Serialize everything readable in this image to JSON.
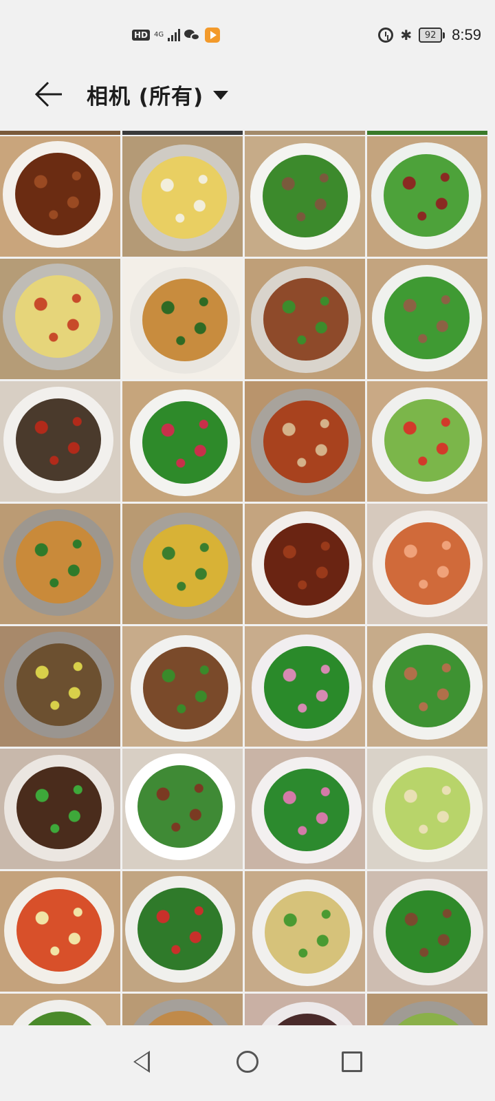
{
  "status_bar": {
    "hd_label": "HD",
    "network_label": "4G",
    "battery_level": "92",
    "time": "8:59"
  },
  "header": {
    "title": "相机 (所有)"
  },
  "colors": {
    "background": "#f1f1f1",
    "text": "#1d1d1d",
    "app_icon_orange": "#f39a2b"
  },
  "photos": [
    {
      "name": "braised-pork",
      "bg": "#c9a57c",
      "plate": "#f4f1ec",
      "food": "#6b2c12",
      "accent": "#9a4a22"
    },
    {
      "name": "eggs-onion",
      "bg": "#b49a76",
      "plate": "#cfcbc4",
      "food": "#e9cf62",
      "accent": "#f2eedb"
    },
    {
      "name": "chive-pork",
      "bg": "#c6ab88",
      "plate": "#f4f4f1",
      "food": "#3c8a2c",
      "accent": "#7a5a3c"
    },
    {
      "name": "sausage-greens",
      "bg": "#c4a47e",
      "plate": "#eef1ee",
      "food": "#4da23a",
      "accent": "#8a2a22"
    },
    {
      "name": "potato-strips",
      "bg": "#b59c77",
      "plate": "#bfbcb6",
      "food": "#e6d57a",
      "accent": "#c84a2a"
    },
    {
      "name": "tofu-greens",
      "bg": "#f3efe8",
      "plate": "#e9e6e0",
      "food": "#c88c3e",
      "accent": "#2f6a24"
    },
    {
      "name": "table-spread",
      "bg": "#bf9f78",
      "plate": "#d9d4cc",
      "food": "#8e4a2a",
      "accent": "#3c8c2c"
    },
    {
      "name": "green-bean-pork",
      "bg": "#c3a47f",
      "plate": "#f0f1ee",
      "food": "#3f9a33",
      "accent": "#8c6244"
    },
    {
      "name": "braised-fish",
      "bg": "#d8cfc4",
      "plate": "#f2f0ed",
      "food": "#4a3a2c",
      "accent": "#b12a1a"
    },
    {
      "name": "stir-fry-greens",
      "bg": "#c6a57c",
      "plate": "#f3f3f0",
      "food": "#2e8a2a",
      "accent": "#c8304a"
    },
    {
      "name": "spicy-fish-stew",
      "bg": "#b9946c",
      "plate": "#a8a39c",
      "food": "#a8421e",
      "accent": "#d4b28a"
    },
    {
      "name": "loofah",
      "bg": "#c9a985",
      "plate": "#f0f0ee",
      "food": "#7bb64a",
      "accent": "#d23a2a"
    },
    {
      "name": "mushroom-chili",
      "bg": "#bb9b74",
      "plate": "#9d978f",
      "food": "#c98a3a",
      "accent": "#2f7a2a"
    },
    {
      "name": "mushroom-beans",
      "bg": "#b99a72",
      "plate": "#a6a19a",
      "food": "#d8b236",
      "accent": "#3b7e2e"
    },
    {
      "name": "braised-ribs",
      "bg": "#c4a47f",
      "plate": "#f2efec",
      "food": "#6a2412",
      "accent": "#9a3a1a"
    },
    {
      "name": "shrimp",
      "bg": "#d6c9bd",
      "plate": "#f1ede9",
      "food": "#d06a3a",
      "accent": "#f0a27a"
    },
    {
      "name": "steamed-fish",
      "bg": "#a8896a",
      "plate": "#9a9590",
      "food": "#6c5030",
      "accent": "#d8d04a"
    },
    {
      "name": "tofu-peppers",
      "bg": "#c7ab8a",
      "plate": "#f1f1ef",
      "food": "#7a4a2a",
      "accent": "#3a8a2a"
    },
    {
      "name": "leafy-greens",
      "bg": "#c8ac8c",
      "plate": "#f1eef0",
      "food": "#2a8a2a",
      "accent": "#d68ab2"
    },
    {
      "name": "chive-meat",
      "bg": "#c6ab8a",
      "plate": "#f2f2ef",
      "food": "#3e9232",
      "accent": "#b0704a"
    },
    {
      "name": "beef-peppers",
      "bg": "#c8b8ab",
      "plate": "#ebe6e1",
      "food": "#4a2c1c",
      "accent": "#3ea83a"
    },
    {
      "name": "dinner-table",
      "bg": "#d8cfc4",
      "plate": "#ffffff",
      "food": "#3f8a35",
      "accent": "#7a3a22"
    },
    {
      "name": "seaweed-greens",
      "bg": "#c9b4a6",
      "plate": "#f3f0f0",
      "food": "#2c8a2e",
      "accent": "#d47aa8"
    },
    {
      "name": "melon-egg",
      "bg": "#d9d2c8",
      "plate": "#f2f1ea",
      "food": "#b8d46a",
      "accent": "#e9e0b4"
    },
    {
      "name": "tomato-egg",
      "bg": "#c4a27c",
      "plate": "#f2efe9",
      "food": "#d8502a",
      "accent": "#f1e4a6"
    },
    {
      "name": "garlic-scape",
      "bg": "#c1a582",
      "plate": "#f0f0ed",
      "food": "#2f7a2a",
      "accent": "#c8302a"
    },
    {
      "name": "tofu-strips",
      "bg": "#c6aa89",
      "plate": "#f1f0ee",
      "food": "#d6c27a",
      "accent": "#4a9a32"
    },
    {
      "name": "beans-pork",
      "bg": "#cdbcb0",
      "plate": "#efebe8",
      "food": "#2f8a2a",
      "accent": "#7a4a2e"
    },
    {
      "name": "partial-1",
      "bg": "#c7a781",
      "plate": "#f0efec",
      "food": "#4a8a2a",
      "accent": "#7a4a2a"
    },
    {
      "name": "partial-2",
      "bg": "#b99a74",
      "plate": "#a5a09a",
      "food": "#c08a4a",
      "accent": "#3a7a2a"
    },
    {
      "name": "partial-3",
      "bg": "#c9b0a4",
      "plate": "#ede9ea",
      "food": "#4a2a2a",
      "accent": "#b0406a"
    },
    {
      "name": "partial-4",
      "bg": "#b59570",
      "plate": "#a09b94",
      "food": "#8ab04a",
      "accent": "#c8a43a"
    }
  ]
}
